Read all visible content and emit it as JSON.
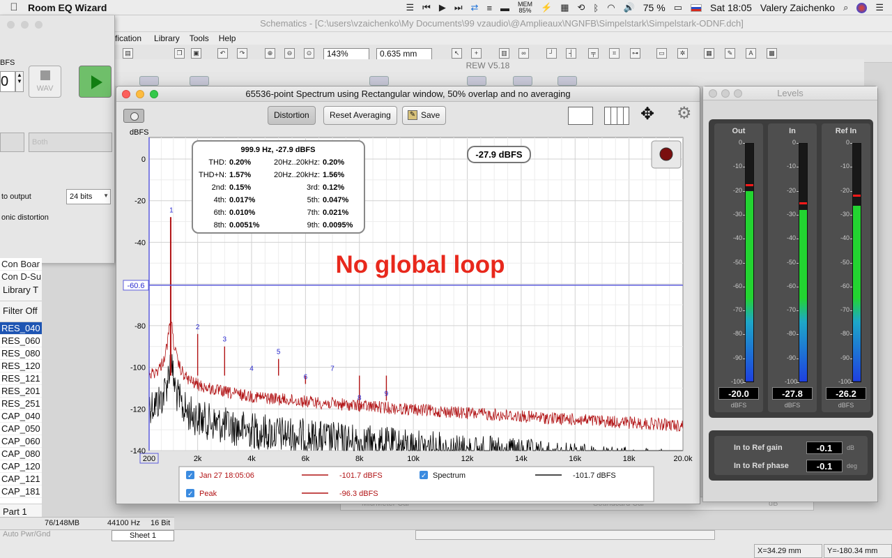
{
  "menubar": {
    "app_name": "Room EQ Wizard",
    "mem_label": "MEM",
    "mem_percent": "85%",
    "battery": "75 %",
    "clock": "Sat 18:05",
    "user": "Valery Zaichenko"
  },
  "schematics": {
    "title": "Schematics - [C:\\users\\vzaichenko\\My Documents\\99 vzaudio\\@Amplieaux\\NGNFB\\Simpelstark\\Simpelstark-ODNF.dch]",
    "menu": [
      "fication",
      "Library",
      "Tools",
      "Help"
    ],
    "zoom": "143%",
    "grid": "0.635 mm",
    "rew_title": "REW V5.18",
    "status_mem": "76/148MB",
    "status_rate": "44100 Hz",
    "status_bits": "16 Bit",
    "sheet_tab": "Sheet 1",
    "auto_pwr": "Auto Pwr/Gnd",
    "coord_x": "X=34.29 mm",
    "coord_y": "Y=-180.34 mm",
    "bg_row_left": "Mic/Meter Cal",
    "bg_row_mid": "Soundcard Cal",
    "bg_row_right": "dB"
  },
  "left_panel": {
    "dbfs_label": "BFS",
    "level_value": "0",
    "wav_label": "WAV",
    "select_left": "",
    "select_right": "Both",
    "output_label": "to output",
    "bits_value": "24 bits",
    "harmonic_label": "onic distortion"
  },
  "library": {
    "rows_top": [
      "Con Boar",
      "Con D-Su"
    ],
    "tab_library": "Library T",
    "tab_filter": "Filter Off",
    "items": [
      "RES_040",
      "RES_060",
      "RES_080",
      "RES_120",
      "RES_121",
      "RES_201",
      "RES_251",
      "CAP_040",
      "CAP_050",
      "CAP_060",
      "CAP_080",
      "CAP_120",
      "CAP_121",
      "CAP_181"
    ],
    "selected_index": 0,
    "part_label": "Part 1"
  },
  "spectrum_window": {
    "title": "65536-point Spectrum using Rectangular window, 50% overlap and no averaging",
    "btn_distortion": "Distortion",
    "btn_reset": "Reset Averaging",
    "btn_save": "Save"
  },
  "chart_data": {
    "type": "line",
    "ylabel": "dBFS",
    "xunit": "Hz",
    "xlim": [
      200,
      20000
    ],
    "ylim": [
      -140,
      10
    ],
    "x_ticks": [
      200,
      2000,
      4000,
      6000,
      8000,
      10000,
      12000,
      14000,
      16000,
      18000,
      20000
    ],
    "x_tick_labels": [
      "200",
      "2k",
      "4k",
      "6k",
      "8k",
      "10k",
      "12k",
      "14k",
      "16k",
      "18k",
      "20.0k"
    ],
    "y_ticks": [
      0,
      -20,
      -40,
      -80,
      -100,
      -120,
      -140
    ],
    "y_tick_labels": [
      "0",
      "-20",
      "-40",
      "-80",
      "-100",
      "-120",
      "-140"
    ],
    "cursor_level": -60.6,
    "cursor_label": "-60.6",
    "peak_readout": "-27.9 dBFS",
    "annotation": "No global loop",
    "annotation_color": "#e8281c",
    "harmonics": [
      {
        "n": "1",
        "freq": 1000,
        "level": -27.9
      },
      {
        "n": "2",
        "freq": 2000,
        "level": -84
      },
      {
        "n": "3",
        "freq": 3000,
        "level": -90
      },
      {
        "n": "4",
        "freq": 4000,
        "level": -104
      },
      {
        "n": "5",
        "freq": 5000,
        "level": -96
      },
      {
        "n": "6",
        "freq": 6000,
        "level": -108
      },
      {
        "n": "7",
        "freq": 7000,
        "level": -104
      },
      {
        "n": "8",
        "freq": 8000,
        "level": -118
      },
      {
        "n": "9",
        "freq": 9000,
        "level": -116
      }
    ],
    "series": [
      {
        "name": "Jan 27 18:05:06",
        "color": "#b11214",
        "legend_value": "-101.7 dBFS",
        "floor_start": -104,
        "floor_end": -125
      },
      {
        "name": "Peak",
        "color": "#b11214",
        "legend_value": "-96.3 dBFS"
      },
      {
        "name": "Spectrum",
        "color": "#000000",
        "legend_value": "-101.7 dBFS",
        "floor_start": -112,
        "floor_end": -140
      }
    ]
  },
  "distortion_box": {
    "header": "999.9 Hz, -27.9 dBFS",
    "rows": [
      {
        "l1": "THD:",
        "v1": "0.20%",
        "l2": "20Hz..20kHz:",
        "v2": "0.20%"
      },
      {
        "l1": "THD+N:",
        "v1": "1.57%",
        "l2": "20Hz..20kHz:",
        "v2": "1.56%"
      },
      {
        "l1": "2nd:",
        "v1": "0.15%",
        "l2": "3rd:",
        "v2": "0.12%"
      },
      {
        "l1": "4th:",
        "v1": "0.017%",
        "l2": "5th:",
        "v2": "0.047%"
      },
      {
        "l1": "6th:",
        "v1": "0.010%",
        "l2": "7th:",
        "v2": "0.021%"
      },
      {
        "l1": "8th:",
        "v1": "0.0051%",
        "l2": "9th:",
        "v2": "0.0095%"
      }
    ]
  },
  "levels": {
    "title": "Levels",
    "scale": [
      "0",
      "-10",
      "-20",
      "-30",
      "-40",
      "-50",
      "-60",
      "-70",
      "-80",
      "-90",
      "-100"
    ],
    "meters": [
      {
        "name": "Out",
        "value": "-20.0",
        "level": -20.0,
        "peak": -17,
        "unit": "dBFS"
      },
      {
        "name": "In",
        "value": "-27.8",
        "level": -27.8,
        "peak": -24.5,
        "unit": "dBFS"
      },
      {
        "name": "Ref In",
        "value": "-26.2",
        "level": -26.2,
        "peak": -21.5,
        "unit": "dBFS"
      }
    ],
    "gain_label": "In to Ref gain",
    "gain_value": "-0.1",
    "gain_unit": "dB",
    "phase_label": "In to Ref phase",
    "phase_value": "-0.1",
    "phase_unit": "deg"
  }
}
